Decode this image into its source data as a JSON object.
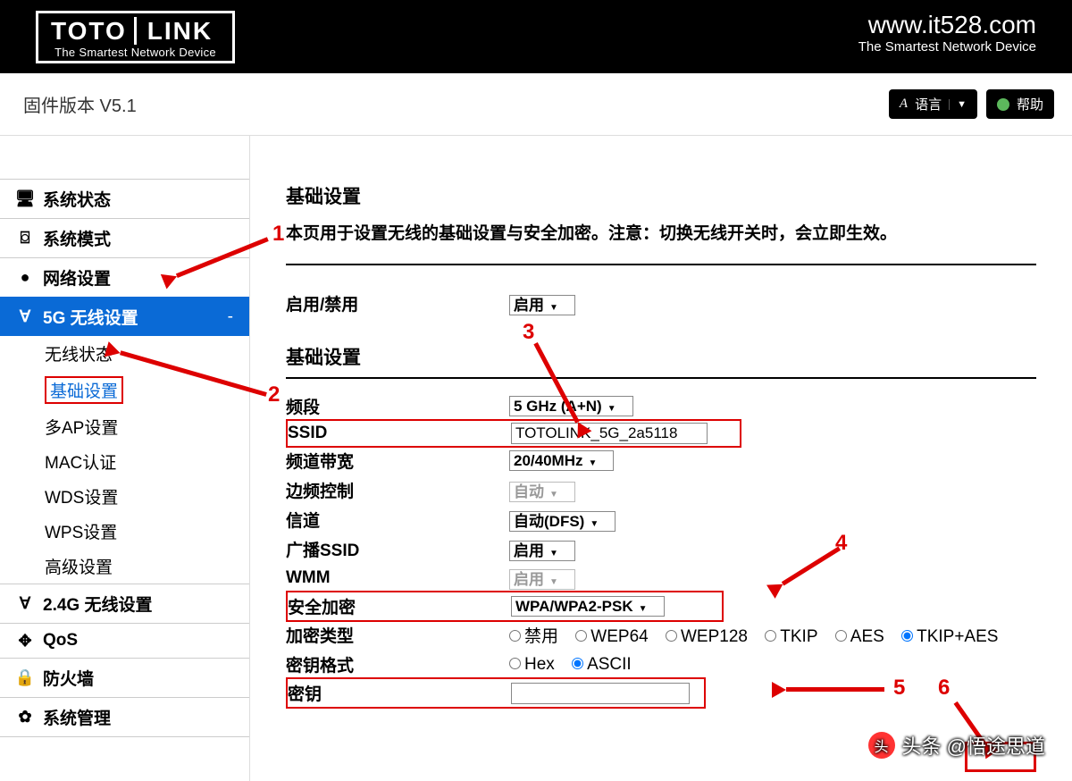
{
  "header": {
    "brand_a": "TOTO",
    "brand_b": "LINK",
    "brand_sub": "The Smartest Network Device",
    "right_url": "www.it528.com",
    "right_sub": "The Smartest Network Device"
  },
  "toolbar": {
    "fw_version": "固件版本 V5.1",
    "lang_label": "语言",
    "help_label": "帮助",
    "lang_icon_text": "A"
  },
  "sidebar": {
    "items": [
      {
        "icon": "monitor",
        "label": "系统状态"
      },
      {
        "icon": "segment",
        "label": "系统模式"
      },
      {
        "icon": "globe",
        "label": "网络设置"
      },
      {
        "icon": "wifi",
        "label": "5G 无线设置",
        "active": true
      },
      {
        "icon": "wifi",
        "label": "2.4G 无线设置"
      },
      {
        "icon": "qos",
        "label": "QoS"
      },
      {
        "icon": "lock",
        "label": "防火墙"
      },
      {
        "icon": "gear",
        "label": "系统管理"
      }
    ],
    "sub": [
      "无线状态",
      "基础设置",
      "多AP设置",
      "MAC认证",
      "WDS设置",
      "WPS设置",
      "高级设置"
    ]
  },
  "content": {
    "title1": "基础设置",
    "desc": "本页用于设置无线的基础设置与安全加密。注意：切换无线开关时，会立即生效。",
    "enable_label": "启用/禁用",
    "enable_value": "启用",
    "title2": "基础设置",
    "band_label": "频段",
    "band_value": "5 GHz (A+N)",
    "ssid_label": "SSID",
    "ssid_value": "TOTOLINK_5G_2a5118",
    "bw_label": "频道带宽",
    "bw_value": "20/40MHz",
    "sideband_label": "边频控制",
    "sideband_value": "自动",
    "channel_label": "信道",
    "channel_value": "自动(DFS)",
    "bcast_label": "广播SSID",
    "bcast_value": "启用",
    "wmm_label": "WMM",
    "wmm_value": "启用",
    "sec_label": "安全加密",
    "sec_value": "WPA/WPA2-PSK",
    "enc_label": "加密类型",
    "enc_opts": [
      "禁用",
      "WEP64",
      "WEP128",
      "TKIP",
      "AES",
      "TKIP+AES"
    ],
    "enc_selected": "TKIP+AES",
    "keyfmt_label": "密钥格式",
    "keyfmt_opts": [
      "Hex",
      "ASCII"
    ],
    "keyfmt_selected": "ASCII",
    "key_label": "密钥"
  },
  "anno": {
    "n1": "1",
    "n2": "2",
    "n3": "3",
    "n4": "4",
    "n5": "5",
    "n6": "6"
  },
  "watermark": "头条 @悟途思道"
}
